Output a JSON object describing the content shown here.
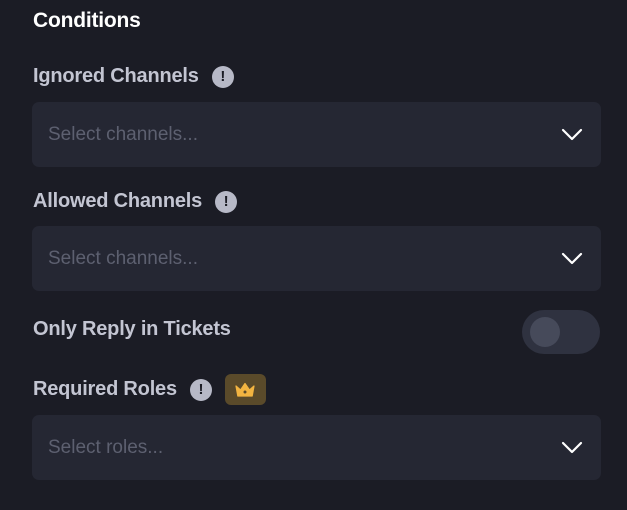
{
  "conditions": {
    "title": "Conditions",
    "ignored_channels": {
      "label": "Ignored Channels",
      "info": "!",
      "placeholder": "Select channels..."
    },
    "allowed_channels": {
      "label": "Allowed Channels",
      "info": "!",
      "placeholder": "Select channels..."
    },
    "only_reply_in_tickets": {
      "label": "Only Reply in Tickets",
      "enabled": false
    },
    "required_roles": {
      "label": "Required Roles",
      "info": "!",
      "premium_icon": "crown-icon",
      "placeholder": "Select roles..."
    }
  },
  "colors": {
    "background": "#1b1c25",
    "field_background": "#252733",
    "label": "#c3c5d2",
    "placeholder": "#5d6070",
    "premium_badge": "#5a4a2a",
    "crown": "#f2b441"
  }
}
